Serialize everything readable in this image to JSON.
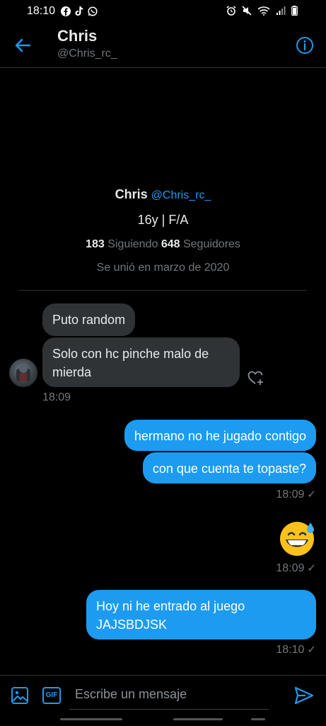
{
  "status_bar": {
    "time": "18:10",
    "left_icons": [
      "facebook-icon",
      "tiktok-icon",
      "whatsapp-icon"
    ],
    "right_icons": [
      "alarm-icon",
      "mute-icon",
      "wifi-icon",
      "signal-icon",
      "battery-icon"
    ]
  },
  "header": {
    "name": "Chris",
    "handle": "@Chris_rc_"
  },
  "profile": {
    "name": "Chris",
    "handle": "@Chris_rc_",
    "bio": "16y | F/A",
    "following_count": "183",
    "following_label": "Siguiendo",
    "followers_count": "648",
    "followers_label": "Seguidores",
    "joined": "Se unió en marzo de 2020"
  },
  "messages": {
    "in_1": "Puto random",
    "in_2": "Solo con hc pinche malo de mierda",
    "in_time": "18:09",
    "out_1": "hermano no he jugado contigo",
    "out_2": "con que cuenta te topaste?",
    "out_time_1": "18:09",
    "emoji_time": "18:09",
    "out_3": "Hoy ni he entrado al juego JAJSBDJSK",
    "out_time_3": "18:10",
    "read_mark": "✓"
  },
  "composer": {
    "gif_label": "GIF",
    "placeholder": "Escribe un mensaje"
  },
  "colors": {
    "accent": "#1d9bf0",
    "background": "#000000",
    "incoming_bubble": "#2f3336",
    "muted_text": "#71767b"
  }
}
